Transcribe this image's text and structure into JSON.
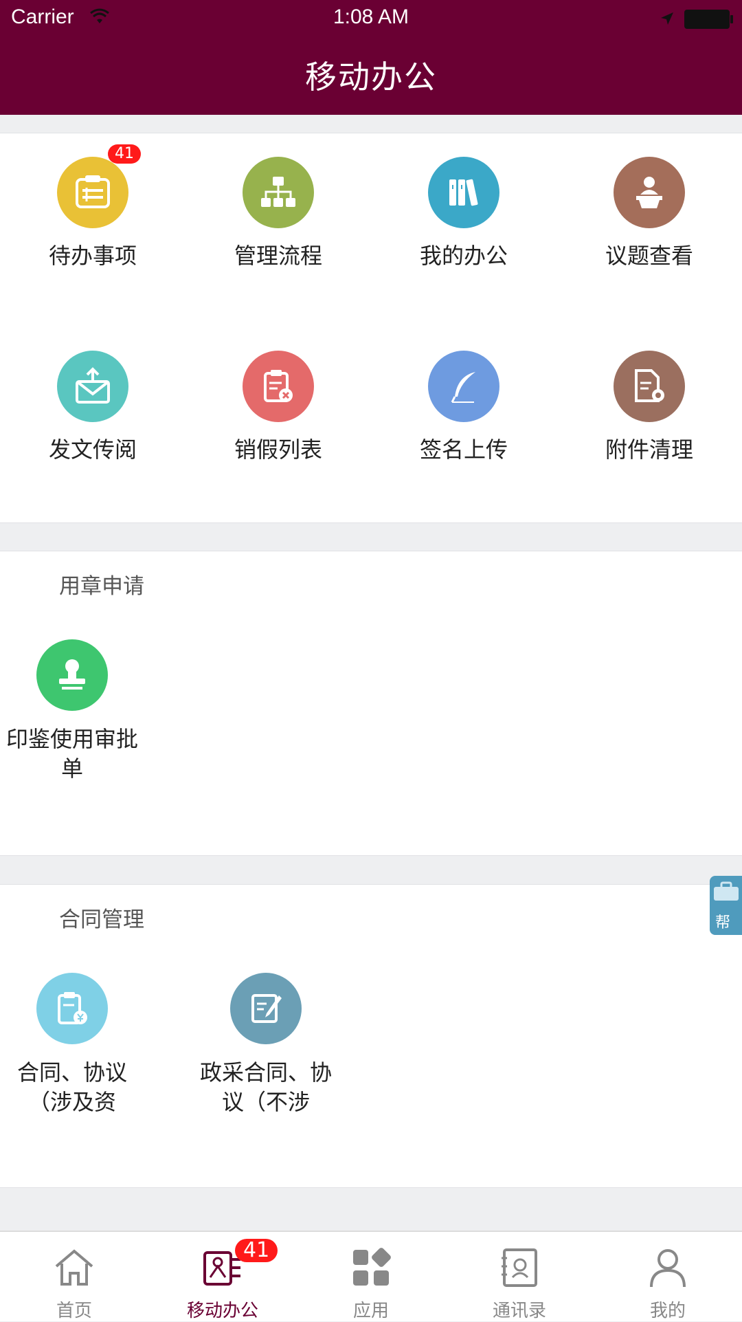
{
  "status_bar": {
    "carrier": "Carrier",
    "time": "1:08 AM"
  },
  "header": {
    "title": "移动办公"
  },
  "quick_grid": {
    "items": [
      {
        "label": "待办事项",
        "icon": "calendar-list-icon",
        "color": "#e9c136",
        "badge": "41"
      },
      {
        "label": "管理流程",
        "icon": "org-chart-icon",
        "color": "#97b24d"
      },
      {
        "label": "我的办公",
        "icon": "books-icon",
        "color": "#3ba8c8"
      },
      {
        "label": "议题查看",
        "icon": "speaker-podium-icon",
        "color": "#a46e5a"
      },
      {
        "label": "发文传阅",
        "icon": "envelope-upload-icon",
        "color": "#5ac6c0"
      },
      {
        "label": "销假列表",
        "icon": "clipboard-cancel-icon",
        "color": "#e46a6a"
      },
      {
        "label": "签名上传",
        "icon": "feather-pen-icon",
        "color": "#6e9be0"
      },
      {
        "label": "附件清理",
        "icon": "document-gear-icon",
        "color": "#9b6f5f"
      }
    ]
  },
  "seal_section": {
    "title": "用章申请",
    "items": [
      {
        "label": "印鉴使用审批单",
        "icon": "stamp-icon",
        "color": "#3ec66f"
      }
    ]
  },
  "contract_section": {
    "title": "合同管理",
    "items": [
      {
        "label": "合同、协议（涉及资",
        "icon": "clipboard-yuan-icon",
        "color": "#7fd0e6"
      },
      {
        "label": "政采合同、协议（不涉",
        "icon": "edit-form-icon",
        "color": "#6b9fb5"
      }
    ]
  },
  "floating_help": {
    "label": "帮"
  },
  "tabbar": {
    "tabs": [
      {
        "label": "首页",
        "icon": "home-icon"
      },
      {
        "label": "移动办公",
        "icon": "id-card-icon",
        "badge": "41",
        "active": true
      },
      {
        "label": "应用",
        "icon": "grid-apps-icon"
      },
      {
        "label": "通讯录",
        "icon": "contacts-book-icon"
      },
      {
        "label": "我的",
        "icon": "person-icon"
      }
    ]
  },
  "colors": {
    "brand": "#6a0033",
    "badge": "#ff1a1a",
    "tab_inactive": "#888888"
  }
}
